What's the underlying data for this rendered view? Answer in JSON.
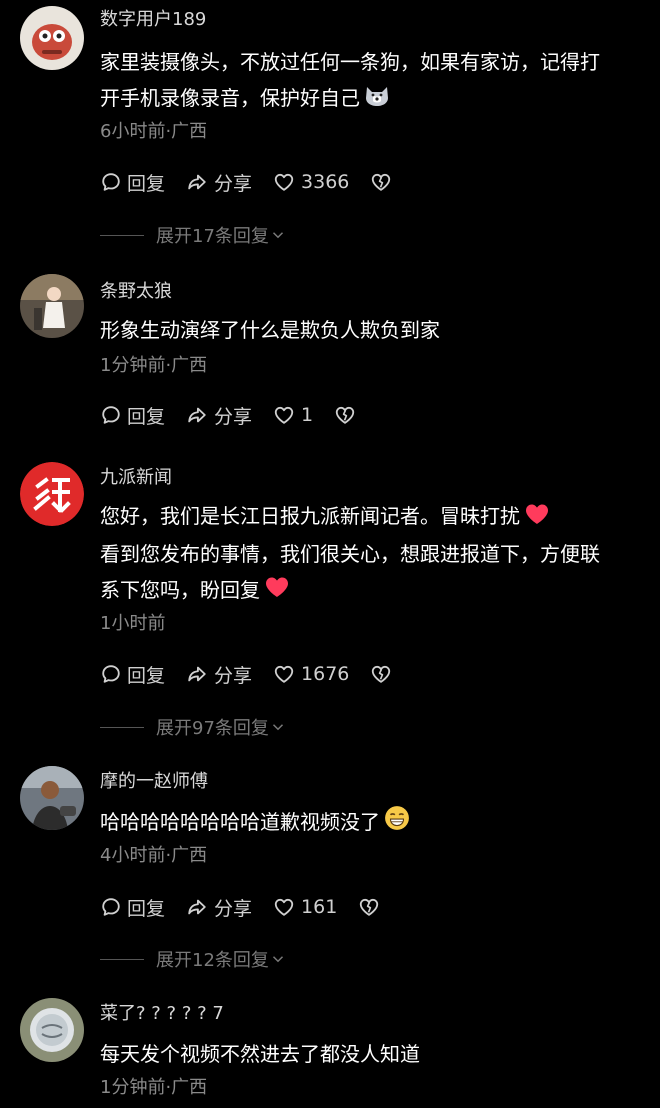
{
  "comments": [
    {
      "user": "数字用户189",
      "lines": [
        "家里装摄像头，不放过任何一条狗，如果有家访，记得打",
        "开手机录像录音，保护好自己"
      ],
      "meta": "6小时前·广西",
      "reply": "回复",
      "share": "分享",
      "likes": "3366",
      "expand": "展开17条回复"
    },
    {
      "user": "条野太狼",
      "lines": [
        "形象生动演绎了什么是欺负人欺负到家"
      ],
      "meta": "1分钟前·广西",
      "reply": "回复",
      "share": "分享",
      "likes": "1"
    },
    {
      "user": "九派新闻",
      "lines": [
        "您好，我们是长江日报九派新闻记者。冒昧打扰",
        "看到您发布的事情，我们很关心，想跟进报道下，方便联",
        "系下您吗，盼回复"
      ],
      "meta": "1小时前",
      "reply": "回复",
      "share": "分享",
      "likes": "1676",
      "expand": "展开97条回复"
    },
    {
      "user": "摩的一赵师傅",
      "lines": [
        "哈哈哈哈哈哈哈哈道歉视频没了"
      ],
      "meta": "4小时前·广西",
      "reply": "回复",
      "share": "分享",
      "likes": "161",
      "expand": "展开12条回复"
    },
    {
      "user": "菜了? ? ? ? ? 7",
      "lines": [
        "每天发个视频不然进去了都没人知道"
      ],
      "meta": "1分钟前·广西"
    }
  ],
  "icons": {
    "reply": "comment-bubble-icon",
    "share": "share-arrow-icon",
    "like": "heart-outline-icon",
    "dislike": "broken-heart-icon"
  },
  "colors": {
    "background": "#000000",
    "heart_emoji": "#ff3b5c"
  }
}
